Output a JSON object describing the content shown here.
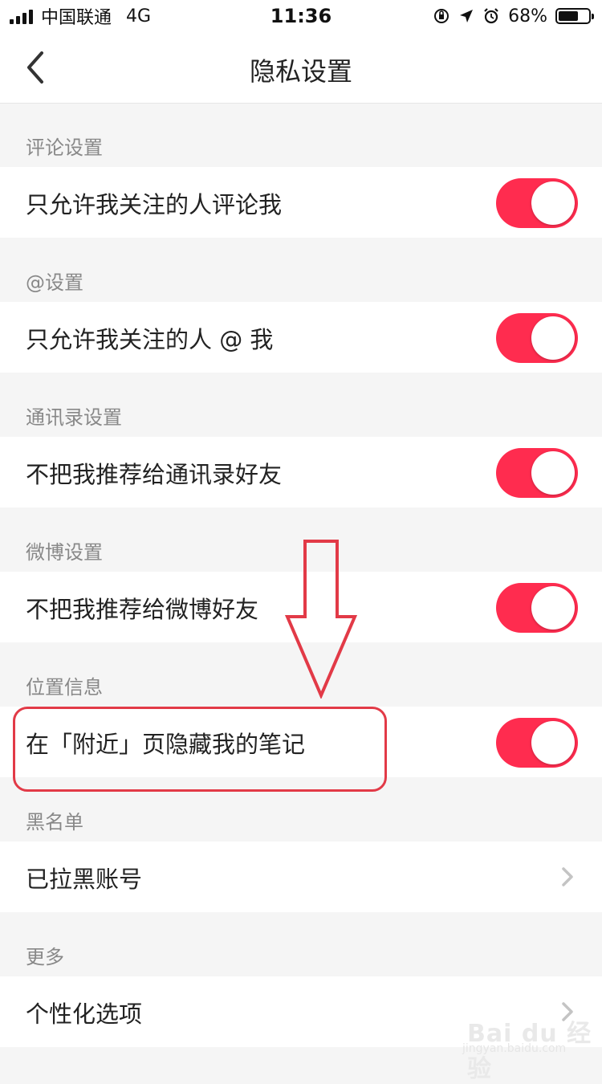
{
  "status_bar": {
    "carrier": "中国联通",
    "network": "4G",
    "time": "11:36",
    "battery": "68%",
    "battery_fraction": 0.68
  },
  "nav": {
    "title": "隐私设置",
    "back_icon": "chevron-left-icon"
  },
  "sections": [
    {
      "title": "评论设置",
      "row": {
        "label": "只允许我关注的人评论我",
        "control": "toggle",
        "on": true
      }
    },
    {
      "title": "@设置",
      "row": {
        "label": "只允许我关注的人 @ 我",
        "control": "toggle",
        "on": true
      }
    },
    {
      "title": "通讯录设置",
      "row": {
        "label": "不把我推荐给通讯录好友",
        "control": "toggle",
        "on": true
      }
    },
    {
      "title": "微博设置",
      "row": {
        "label": "不把我推荐给微博好友",
        "control": "toggle",
        "on": true
      }
    },
    {
      "title": "位置信息",
      "row": {
        "label": "在「附近」页隐藏我的笔记",
        "control": "toggle",
        "on": true
      }
    },
    {
      "title": "黑名单",
      "row": {
        "label": "已拉黑账号",
        "control": "chevron"
      }
    },
    {
      "title": "更多",
      "row": {
        "label": "个性化选项",
        "control": "chevron"
      }
    }
  ],
  "annotation": {
    "arrow": "arrow-down",
    "highlight_color": "#e23a47"
  },
  "watermark": {
    "text": "Bai du 经验",
    "sub": "jingyan.baidu.com"
  },
  "colors": {
    "toggle_on": "#ff2c4f",
    "background": "#f5f5f5"
  }
}
